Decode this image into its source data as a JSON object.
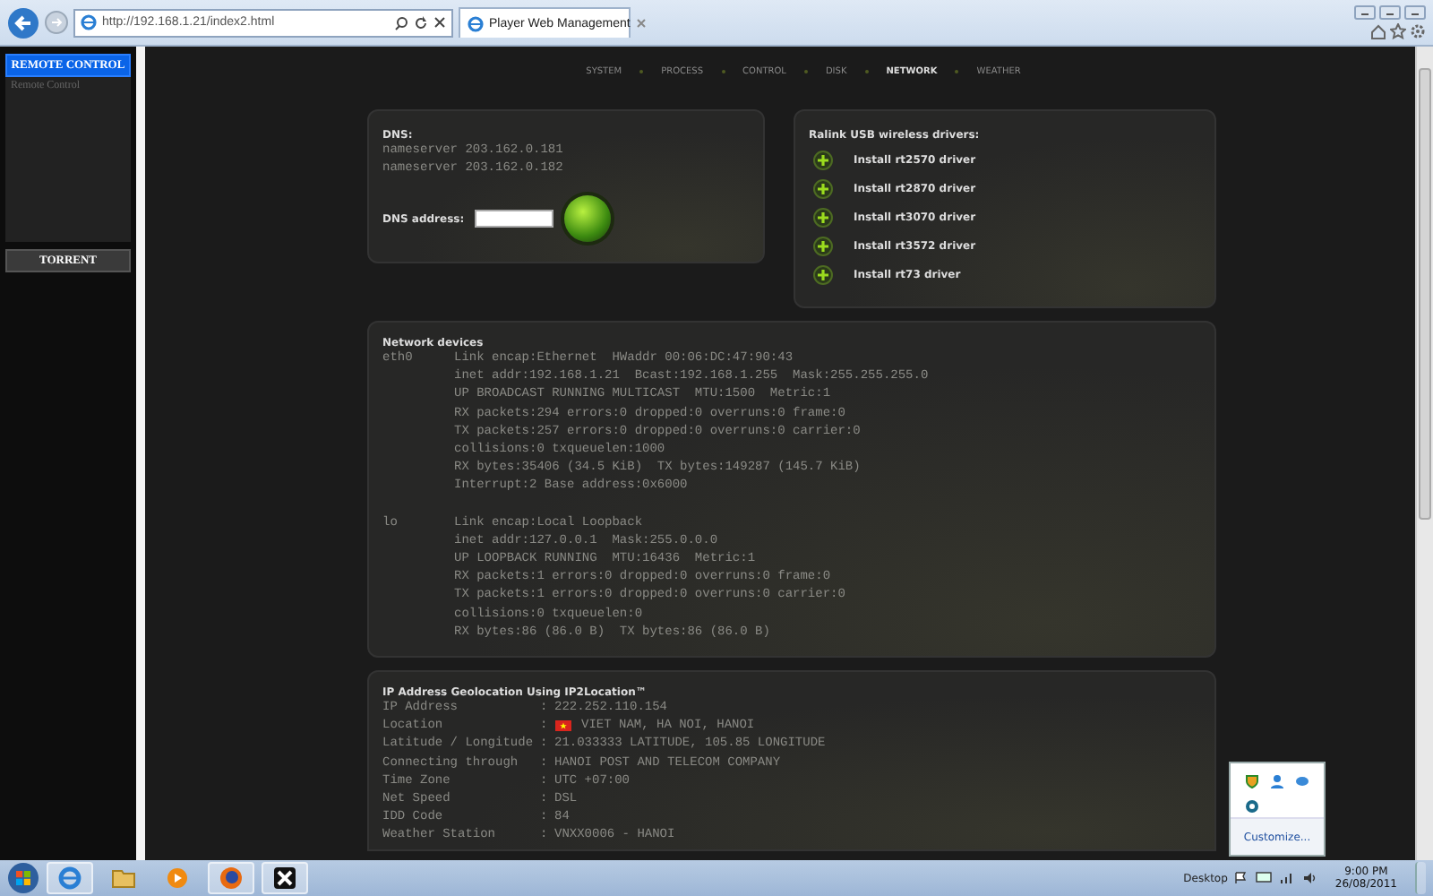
{
  "browser": {
    "url": "http://192.168.1.21/index2.html",
    "tabs": [
      {
        "title": "Player Web Management",
        "selected": true
      }
    ]
  },
  "sidebar": {
    "sections": [
      {
        "title": "REMOTE CONTROL",
        "selected": true,
        "items": [
          "Remote Control"
        ]
      },
      {
        "title": "TORRENT",
        "selected": false
      }
    ]
  },
  "nav": [
    {
      "label": "SYSTEM",
      "selected": false
    },
    {
      "label": "PROCESS",
      "selected": false
    },
    {
      "label": "CONTROL",
      "selected": false
    },
    {
      "label": "DISK",
      "selected": false
    },
    {
      "label": "NETWORK",
      "selected": true
    },
    {
      "label": "WEATHER",
      "selected": false
    }
  ],
  "dns": {
    "title": "DNS:",
    "lines": [
      "nameserver 203.162.0.181",
      "nameserver 203.162.0.182"
    ],
    "field_label": "DNS address:"
  },
  "drivers": {
    "title": "Ralink USB wireless drivers:",
    "items": [
      "Install rt2570 driver",
      "Install rt2870 driver",
      "Install rt3070 driver",
      "Install rt3572 driver",
      "Install rt73 driver"
    ]
  },
  "network_devices": {
    "title": "Network devices",
    "interfaces": [
      {
        "name": "eth0",
        "lines": [
          "Link encap:Ethernet  HWaddr 00:06:DC:47:90:43",
          "inet addr:192.168.1.21  Bcast:192.168.1.255  Mask:255.255.255.0",
          "UP BROADCAST RUNNING MULTICAST  MTU:1500  Metric:1",
          "RX packets:294 errors:0 dropped:0 overruns:0 frame:0",
          "TX packets:257 errors:0 dropped:0 overruns:0 carrier:0",
          "collisions:0 txqueuelen:1000",
          "RX bytes:35406 (34.5 KiB)  TX bytes:149287 (145.7 KiB)",
          "Interrupt:2 Base address:0x6000"
        ]
      },
      {
        "name": "lo",
        "lines": [
          "Link encap:Local Loopback",
          "inet addr:127.0.0.1  Mask:255.0.0.0",
          "UP LOOPBACK RUNNING  MTU:16436  Metric:1",
          "RX packets:1 errors:0 dropped:0 overruns:0 frame:0",
          "TX packets:1 errors:0 dropped:0 overruns:0 carrier:0",
          "collisions:0 txqueuelen:0",
          "RX bytes:86 (86.0 B)  TX bytes:86 (86.0 B)"
        ]
      }
    ]
  },
  "geolocation": {
    "title": "IP Address Geolocation Using IP2Location™",
    "rows": [
      {
        "kind": "text",
        "label": "IP Address",
        "separator": ":",
        "value": "222.252.110.154"
      },
      {
        "kind": "flag",
        "label": "Location",
        "separator": ":",
        "value": "VIET NAM, HA NOI, HANOI"
      },
      {
        "kind": "text",
        "label": "Latitude / Longitude",
        "separator": ":",
        "value": "21.033333 LATITUDE, 105.85 LONGITUDE"
      },
      {
        "kind": "text",
        "label": "Connecting through",
        "separator": ":",
        "value": "HANOI POST AND TELECOM COMPANY"
      },
      {
        "kind": "text",
        "label": "Time Zone",
        "separator": ":",
        "value": "UTC +07:00"
      },
      {
        "kind": "text",
        "label": "Net Speed",
        "separator": ":",
        "value": "DSL"
      },
      {
        "kind": "text",
        "label": "IDD Code",
        "separator": ":",
        "value": "84"
      },
      {
        "kind": "text",
        "label": "Weather Station",
        "separator": ":",
        "value": "VNXX0006 - HANOI"
      }
    ]
  },
  "tray_popup": {
    "link": "Customize..."
  },
  "taskbar": {
    "desktop_label": "Desktop",
    "time": "9:00 PM",
    "date": "26/08/2011"
  }
}
